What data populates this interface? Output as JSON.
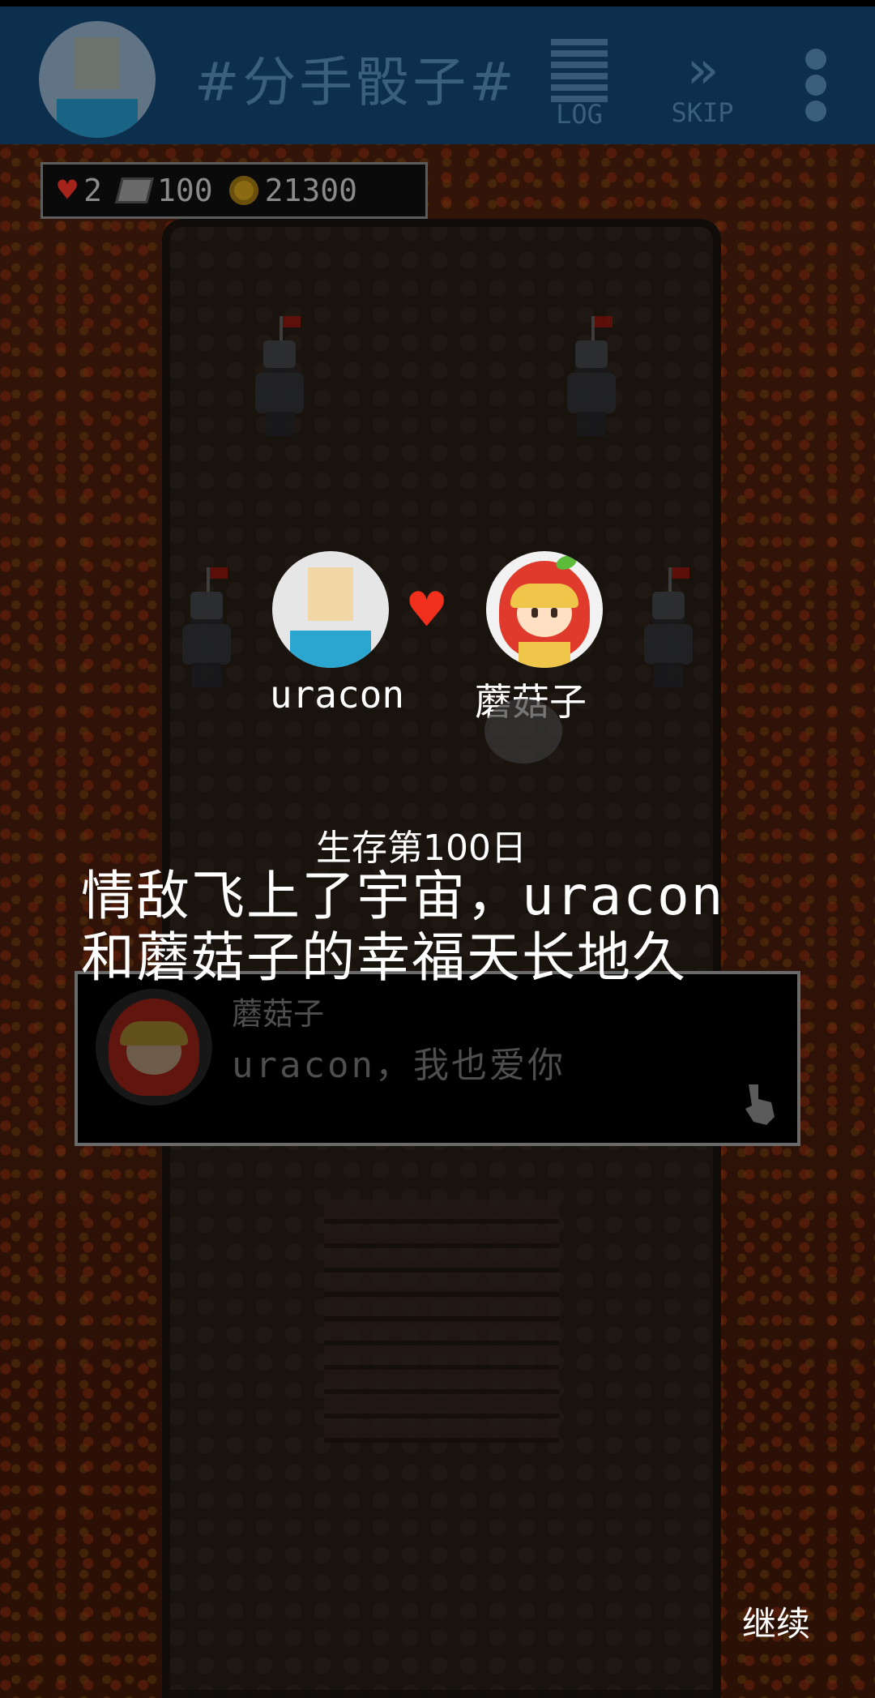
{
  "header": {
    "title": "#分手骰子#",
    "log_label": "LOG",
    "skip_label": "SKIP",
    "icons": {
      "log": "log-list-icon",
      "skip": "fast-forward-icon",
      "more": "more-vertical-icon"
    }
  },
  "stats": {
    "lives": "2",
    "books": "100",
    "coins": "21300",
    "icons": {
      "lives": "heart-icon",
      "books": "book-icon",
      "coins": "coin-icon"
    }
  },
  "couple": {
    "player_name": "uracon",
    "partner_name": "蘑菇子",
    "icons": {
      "link": "heart-icon"
    }
  },
  "story": {
    "day_label": "生存第100日",
    "message": "情敌飞上了宇宙，uracon和蘑菇子的幸福天长地久"
  },
  "dialog": {
    "speaker": "蘑菇子",
    "line": "uracon，我也爱你",
    "icons": {
      "advance": "pointing-hand-icon"
    }
  },
  "footer": {
    "continue_label": "继续"
  },
  "colors": {
    "header_bg": "#0c2f4d",
    "header_fg": "#3a5f7d",
    "heart": "#f0301c",
    "text": "#ffffff"
  }
}
